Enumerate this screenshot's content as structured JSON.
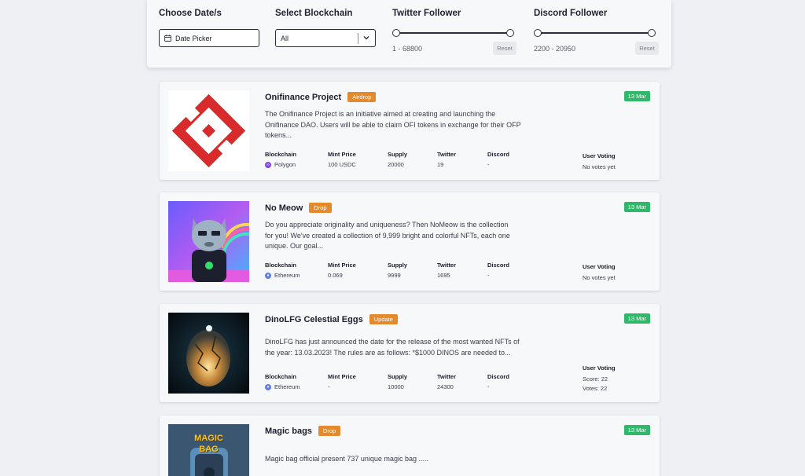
{
  "filters": {
    "date_label": "Choose Date/s",
    "date_placeholder": "Date Picker",
    "chain_label": "Select Blockchain",
    "chain_value": "All",
    "twitter_label": "Twitter Follower",
    "twitter_range": "1 - 68800",
    "discord_label": "Discord Follower",
    "discord_range": "2200 - 20950",
    "reset_label": "Reset"
  },
  "meta_headers": {
    "blockchain": "Blockchain",
    "mint_price": "Mint Price",
    "supply": "Supply",
    "twitter": "Twitter",
    "discord": "Discord",
    "user_voting": "User Voting"
  },
  "projects": [
    {
      "title": "Onifinance Project",
      "tag": "Airdrop",
      "date": "13 Mar",
      "desc_lines": [
        "The Onifinance Project is an initiative aimed at creating and launching the",
        "Onifinance DAO. Users will be able to claim OFI tokens in exchange for their OFP",
        "tokens..."
      ],
      "blockchain": "Polygon",
      "mint_price": "100 USDC",
      "supply": "20000",
      "twitter": "19",
      "discord": "-",
      "voting": [
        "No votes yet"
      ]
    },
    {
      "title": "No Meow",
      "tag": "Drop",
      "date": "13 Mar",
      "desc_lines": [
        "Do you appreciate originality and uniqueness? Then NoMeow is the collection",
        "for you! We've created a collection of 9,999 bright and colorful NFTs, each one",
        "unique. Our goal..."
      ],
      "blockchain": "Ethereum",
      "mint_price": "0.069",
      "supply": "9999",
      "twitter": "1695",
      "discord": "-",
      "voting": [
        "No votes yet"
      ]
    },
    {
      "title": "DinoLFG Celestial Eggs",
      "tag": "Update",
      "date": "13 Mar",
      "desc_lines": [
        "DinoLFG has just announced the date for the release of the most wanted NFTs of",
        "the year: 13.03.2023! The rules are as follows: *$1000 DINOS are needed to..."
      ],
      "blockchain": "Ethereum",
      "mint_price": "-",
      "supply": "10000",
      "twitter": "24300",
      "discord": "-",
      "voting": [
        "Score: 22",
        "Votes: 22"
      ]
    },
    {
      "title": "Magic bags",
      "tag": "Drop",
      "date": "13 Mar",
      "desc_lines": [
        "Magic bag official present 737 unique magic bag ....."
      ],
      "thumb_text": [
        "MAGIC",
        "BAG"
      ]
    }
  ],
  "colors": {
    "tag": "#e58a2c",
    "date_badge": "#2fb86a",
    "polygon": "#8247e5",
    "ethereum": "#627eea"
  },
  "icons": [
    "calendar-icon",
    "chevron-down-icon",
    "polygon-icon",
    "ethereum-icon"
  ]
}
